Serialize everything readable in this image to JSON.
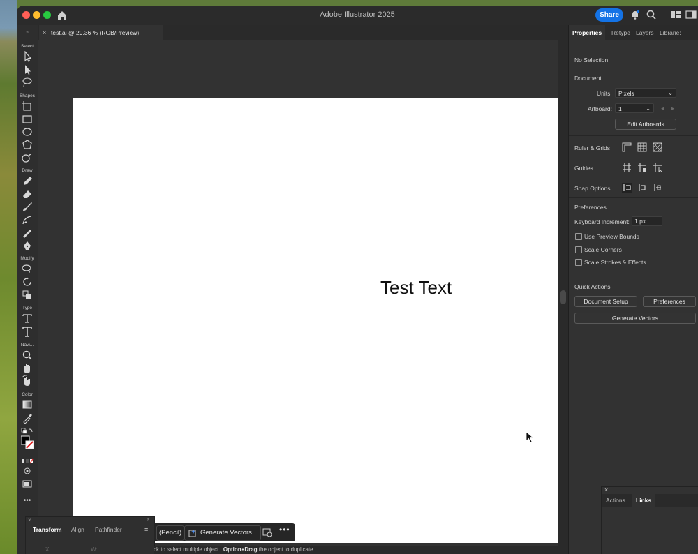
{
  "app": {
    "title": "Adobe Illustrator 2025",
    "share_label": "Share"
  },
  "document": {
    "tab_label": "test.ai @ 29.36 % (RGB/Preview)",
    "close_glyph": "×"
  },
  "toolbar": {
    "sections": {
      "select": "Select",
      "shapes": "Shapes",
      "draw": "Draw",
      "modify": "Modify",
      "type": "Type",
      "navigate": "Navi...",
      "color": "Color"
    },
    "more_glyph": "•••"
  },
  "canvas": {
    "text": "Test Text"
  },
  "properties": {
    "tabs": [
      "Properties",
      "Retype",
      "Layers",
      "Librarie:"
    ],
    "selection": "No Selection",
    "document_heading": "Document",
    "units_label": "Units:",
    "units_value": "Pixels",
    "artboard_label": "Artboard:",
    "artboard_value": "1",
    "edit_artboards": "Edit Artboards",
    "ruler_grids": "Ruler & Grids",
    "guides": "Guides",
    "snap_options": "Snap Options",
    "preferences_heading": "Preferences",
    "keyboard_increment_label": "Keyboard Increment:",
    "keyboard_increment_value": "1 px",
    "use_preview_bounds": "Use Preview Bounds",
    "scale_corners": "Scale Corners",
    "scale_strokes": "Scale Strokes & Effects",
    "quick_actions": "Quick Actions",
    "document_setup": "Document Setup",
    "preferences_btn": "Preferences",
    "generate_vectors": "Generate Vectors"
  },
  "links_panel": {
    "tabs": [
      "Actions",
      "Links"
    ],
    "close_glyph": "×"
  },
  "transform_panel": {
    "tabs": [
      "Transform",
      "Align",
      "Pathfinder"
    ],
    "menu_glyph": "≡",
    "x_label": "X:",
    "w_label": "W:"
  },
  "taskbar": {
    "pencil_label": "(Pencil)",
    "generate_label": "Generate Vectors",
    "more_glyph": "•••"
  },
  "status": {
    "part1": "ck to select multiple object  |  ",
    "part2_bold": "Option+Drag",
    "part3": " the object to duplicate"
  }
}
